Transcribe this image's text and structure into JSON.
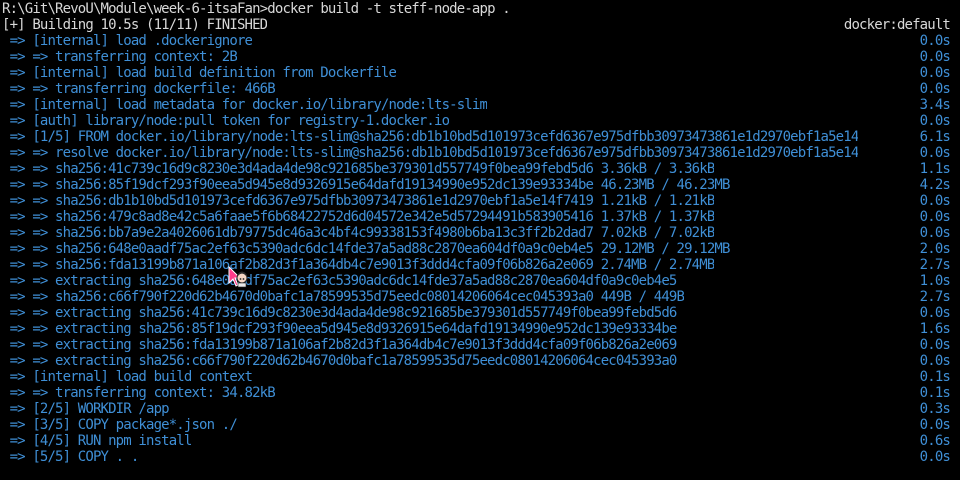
{
  "prompt": {
    "path": "R:\\Git\\RevoU\\Module\\week-6-itsaFan",
    "symbol": ">",
    "command": "docker build -t steff-node-app ."
  },
  "header": {
    "text": "[+] Building 10.5s (11/11) FINISHED",
    "right": "docker:default"
  },
  "lines": [
    {
      "text": " => [internal] load .dockerignore",
      "time": "0.0s"
    },
    {
      "text": " => => transferring context: 2B",
      "time": "0.0s"
    },
    {
      "text": " => [internal] load build definition from Dockerfile",
      "time": "0.0s"
    },
    {
      "text": " => => transferring dockerfile: 466B",
      "time": "0.0s"
    },
    {
      "text": " => [internal] load metadata for docker.io/library/node:lts-slim",
      "time": "3.4s"
    },
    {
      "text": " => [auth] library/node:pull token for registry-1.docker.io",
      "time": "0.0s"
    },
    {
      "text": " => [1/5] FROM docker.io/library/node:lts-slim@sha256:db1b10bd5d101973cefd6367e975dfbb30973473861e1d2970ebf1a5e14",
      "time": "6.1s"
    },
    {
      "text": " => => resolve docker.io/library/node:lts-slim@sha256:db1b10bd5d101973cefd6367e975dfbb30973473861e1d2970ebf1a5e14",
      "time": "0.0s"
    },
    {
      "text": " => => sha256:41c739c16d9c8230e3d4ada4de98c921685be379301d557749f0bea99febd5d6 3.36kB / 3.36kB",
      "time": "1.1s"
    },
    {
      "text": " => => sha256:85f19dcf293f90eea5d945e8d9326915e64dafd19134990e952dc139e93334be 46.23MB / 46.23MB",
      "time": "4.2s"
    },
    {
      "text": " => => sha256:db1b10bd5d101973cefd6367e975dfbb30973473861e1d2970ebf1a5e14f7419 1.21kB / 1.21kB",
      "time": "0.0s"
    },
    {
      "text": " => => sha256:479c8ad8e42c5a6faae5f6b68422752d6d04572e342e5d57294491b583905416 1.37kB / 1.37kB",
      "time": "0.0s"
    },
    {
      "text": " => => sha256:bb7a9e2a4026061db79775dc46a3c4bf4c99338153f4980b6ba13c3ff2b2dad7 7.02kB / 7.02kB",
      "time": "0.0s"
    },
    {
      "text": " => => sha256:648e0aadf75ac2ef63c5390adc6dc14fde37a5ad88c2870ea604df0a9c0eb4e5 29.12MB / 29.12MB",
      "time": "2.0s"
    },
    {
      "text": " => => sha256:fda13199b871a106af2b82d3f1a364db4c7e9013f3ddd4cfa09f06b826a2e069 2.74MB / 2.74MB",
      "time": "2.7s"
    },
    {
      "text": " => => extracting sha256:648e0aadf75ac2ef63c5390adc6dc14fde37a5ad88c2870ea604df0a9c0eb4e5",
      "time": "1.0s"
    },
    {
      "text": " => => sha256:c66f790f220d62b4670d0bafc1a78599535d75eedc08014206064cec045393a0 449B / 449B",
      "time": "2.7s"
    },
    {
      "text": " => => extracting sha256:41c739c16d9c8230e3d4ada4de98c921685be379301d557749f0bea99febd5d6",
      "time": "0.0s"
    },
    {
      "text": " => => extracting sha256:85f19dcf293f90eea5d945e8d9326915e64dafd19134990e952dc139e93334be",
      "time": "1.6s"
    },
    {
      "text": " => => extracting sha256:fda13199b871a106af2b82d3f1a364db4c7e9013f3ddd4cfa09f06b826a2e069",
      "time": "0.0s"
    },
    {
      "text": " => => extracting sha256:c66f790f220d62b4670d0bafc1a78599535d75eedc08014206064cec045393a0",
      "time": "0.0s"
    },
    {
      "text": " => [internal] load build context",
      "time": "0.1s"
    },
    {
      "text": " => => transferring context: 34.82kB",
      "time": "0.1s"
    },
    {
      "text": " => [2/5] WORKDIR /app",
      "time": "0.3s"
    },
    {
      "text": " => [3/5] COPY package*.json ./",
      "time": "0.0s"
    },
    {
      "text": " => [4/5] RUN npm install",
      "time": "0.6s"
    },
    {
      "text": " => [5/5] COPY . .",
      "time": "0.0s"
    }
  ],
  "colors": {
    "background": "#000000",
    "text_white": "#d8d8d8",
    "text_blue": "#3f8fd6"
  },
  "icons": {
    "mouse_cursor": "anime-character-cursor-icon"
  }
}
